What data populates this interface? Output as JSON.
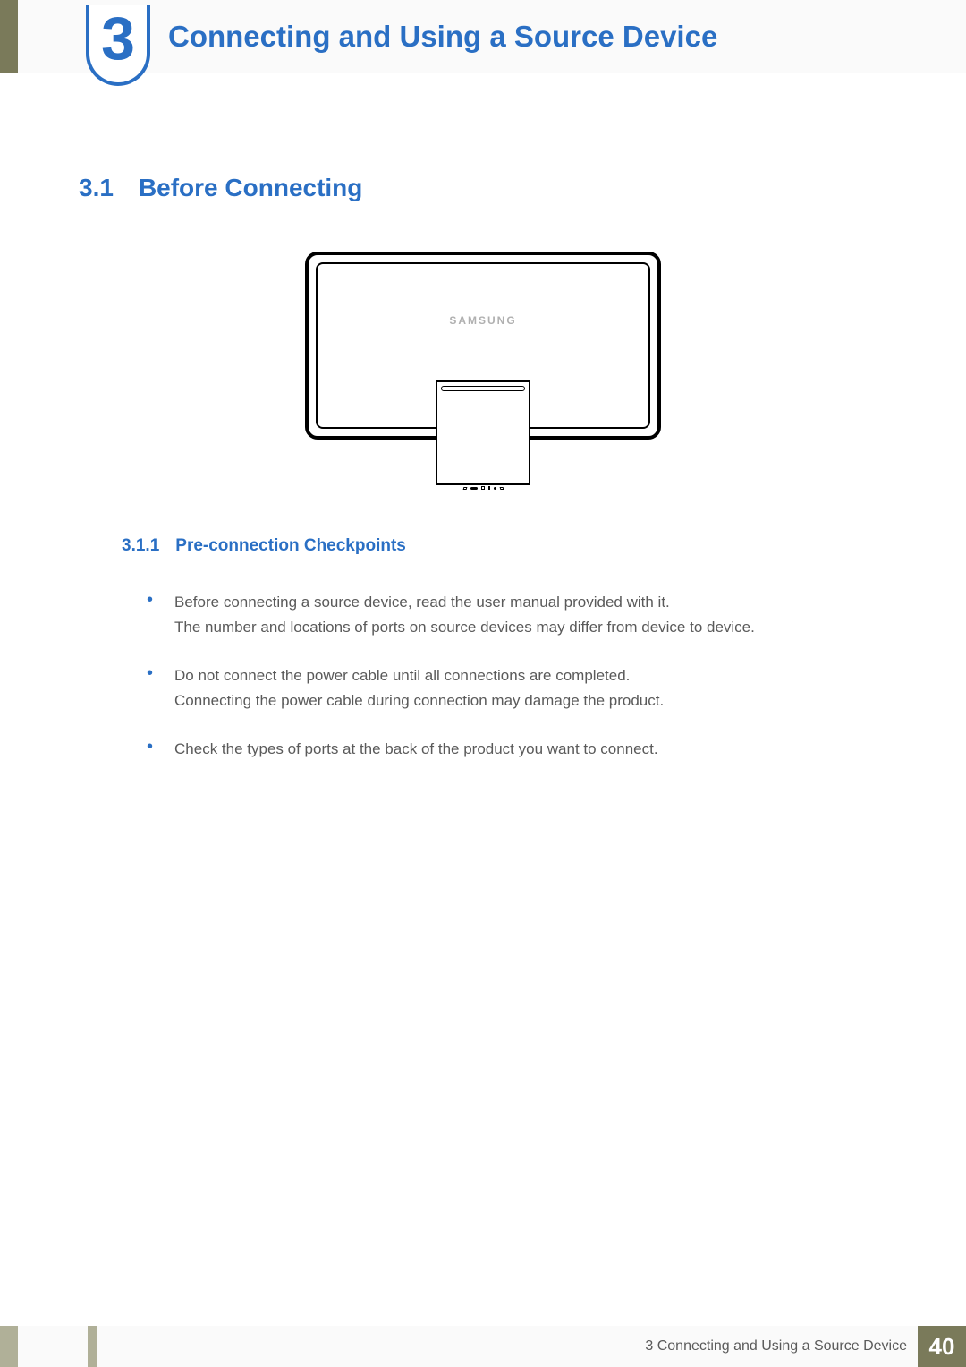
{
  "header": {
    "chapter_number": "3",
    "chapter_title": "Connecting and Using a Source Device"
  },
  "section": {
    "number": "3.1",
    "title": "Before Connecting"
  },
  "monitor": {
    "brand": "SAMSUNG"
  },
  "subsection": {
    "number": "3.1.1",
    "title": "Pre-connection Checkpoints"
  },
  "bullets": [
    {
      "line1": "Before connecting a source device, read the user manual provided with it.",
      "line2": "The number and locations of ports on source devices may differ from device to device."
    },
    {
      "line1": "Do not connect the power cable until all connections are completed.",
      "line2": "Connecting the power cable during connection may damage the product."
    },
    {
      "line1": "Check the types of ports at the back of the product you want to connect.",
      "line2": ""
    }
  ],
  "footer": {
    "text": "3 Connecting and Using a Source Device",
    "page": "40"
  }
}
